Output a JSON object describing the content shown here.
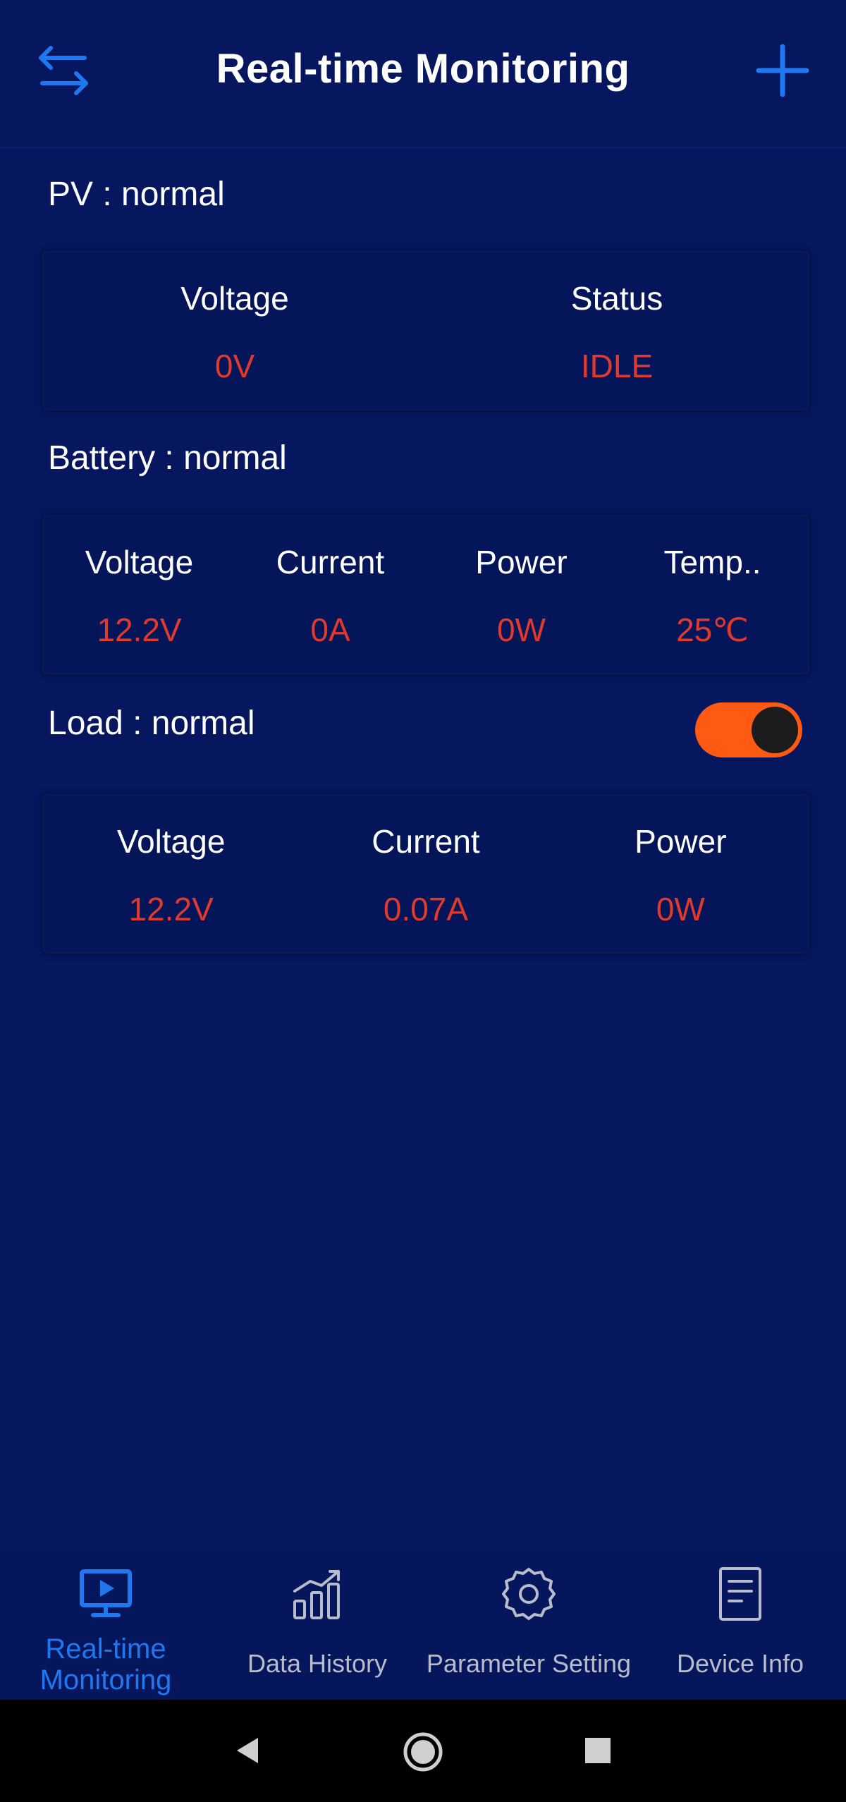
{
  "header": {
    "title": "Real-time Monitoring",
    "left_icon": "swap-arrows-icon",
    "right_icon": "plus-icon"
  },
  "pv": {
    "label": "PV : normal",
    "metrics": [
      {
        "label": "Voltage",
        "value": "0V"
      },
      {
        "label": "Status",
        "value": "IDLE"
      }
    ]
  },
  "battery": {
    "label": "Battery : normal",
    "metrics": [
      {
        "label": "Voltage",
        "value": "12.2V"
      },
      {
        "label": "Current",
        "value": "0A"
      },
      {
        "label": "Power",
        "value": "0W"
      },
      {
        "label": "Temp..",
        "value": "25℃"
      }
    ]
  },
  "load": {
    "label": "Load : normal",
    "toggle_on": true,
    "metrics": [
      {
        "label": "Voltage",
        "value": "12.2V"
      },
      {
        "label": "Current",
        "value": "0.07A"
      },
      {
        "label": "Power",
        "value": "0W"
      }
    ]
  },
  "tabs": [
    {
      "label": "Real-time Monitoring",
      "icon": "monitor-play-icon",
      "active": true
    },
    {
      "label": "Data History",
      "icon": "bar-chart-icon",
      "active": false
    },
    {
      "label": "Parameter Setting",
      "icon": "gear-icon",
      "active": false
    },
    {
      "label": "Device Info",
      "icon": "document-icon",
      "active": false
    }
  ],
  "colors": {
    "background": "#061760",
    "accent": "#1f78f0",
    "value": "#e03a2c",
    "toggle": "#ff5a14"
  }
}
